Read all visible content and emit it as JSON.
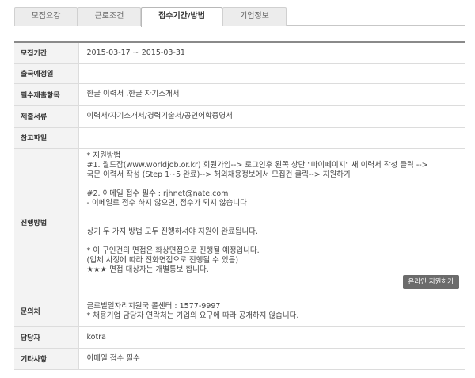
{
  "tabs": [
    {
      "label": "모집요강",
      "active": false
    },
    {
      "label": "근로조건",
      "active": false
    },
    {
      "label": "접수기간/방법",
      "active": true
    },
    {
      "label": "기업정보",
      "active": false
    }
  ],
  "rows": {
    "period": {
      "label": "모집기간",
      "value": "2015-03-17 ~ 2015-03-31"
    },
    "departure": {
      "label": "출국예정일",
      "value": ""
    },
    "required": {
      "label": "필수제출항목",
      "value": "한글 이력서 ,한글 자기소개서"
    },
    "documents": {
      "label": "제출서류",
      "value": "이력서/자기소개서/경력기술서/공인어학증명서"
    },
    "files": {
      "label": "참고파일",
      "value": ""
    },
    "process": {
      "label": "진행방법",
      "lines": [
        "* 지원방법",
        "#1. 월드잡(www.worldjob.or.kr) 회원가입--> 로그인후 왼쪽 상단 \"마이페이지\" 새 이력서 작성 클릭 -->",
        "국문 이력서 작성 (Step 1~5 완료)--> 해외채용정보에서 모집건 클릭--> 지원하기",
        "",
        "#2. 이메일 접수 필수 : rjhnet@nate.com",
        "- 이메일로 접수 하지 않으면, 접수가 되지 않습니다",
        "",
        "",
        "상기 두 가지 방법 모두 진행하셔야 지원이 완료됩니다.",
        "",
        "* 이 구인건의 면접은 화상면접으로 진행될 예정입니다.",
        "(업체 사정에 따라 전화면접으로 진행될 수 있음)",
        "★★★ 면접 대상자는 개별통보 합니다."
      ],
      "button": "온라인 지원하기"
    },
    "contact": {
      "label": "문의처",
      "lines": [
        "글로벌일자리지원국 콜센터 : 1577-9997",
        "* 채용기업 담당자 연락처는 기업의 요구에 따라 공개하지 않습니다."
      ]
    },
    "manager": {
      "label": "담당자",
      "value": "kotra"
    },
    "etc": {
      "label": "기타사항",
      "value": "이메일 접수 필수"
    }
  }
}
